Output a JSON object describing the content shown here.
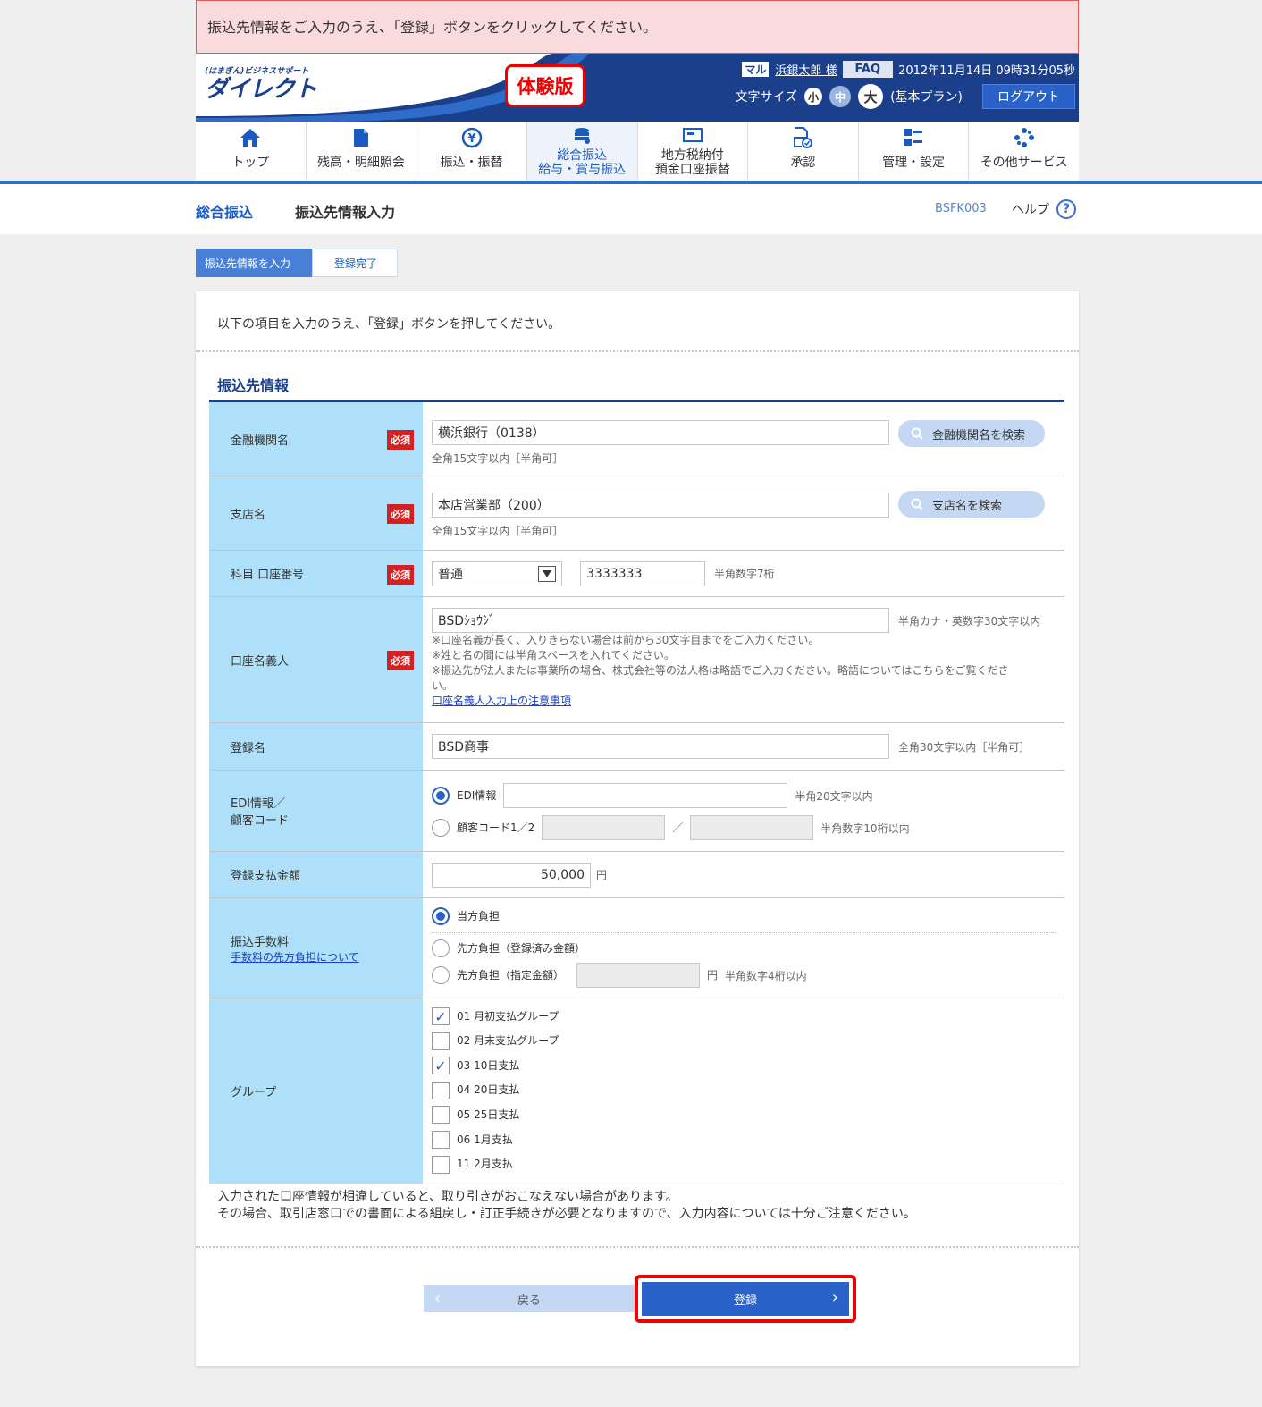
{
  "notice": "振込先情報をご入力のうえ、「登録」ボタンをクリックしてください。",
  "header": {
    "logo_small": "(はまぎん)ビジネスサポート",
    "logo_main": "ダイレクト",
    "trial_badge": "体験版",
    "bank_mark": "マル",
    "user": "浜銀太郎 様",
    "faq": "FAQ",
    "datetime": "2012年11月14日 09時31分05秒",
    "font_size_label": "文字サイズ",
    "font_small": "小",
    "font_medium": "中",
    "font_large": "大",
    "plan": "(基本プラン)",
    "logout": "ログアウト"
  },
  "nav": [
    {
      "label": "トップ",
      "icon": "home-icon"
    },
    {
      "label": "残高・明細照会",
      "icon": "document-icon"
    },
    {
      "label": "振込・振替",
      "icon": "yen-icon"
    },
    {
      "label1": "総合振込",
      "label2": "給与・賞与振込",
      "icon": "database-icon"
    },
    {
      "label1": "地方税納付",
      "label2": "預金口座振替",
      "icon": "tax-icon"
    },
    {
      "label": "承認",
      "icon": "approve-icon"
    },
    {
      "label": "管理・設定",
      "icon": "settings-icon"
    },
    {
      "label": "その他サービス",
      "icon": "service-icon"
    }
  ],
  "title": {
    "crumb1": "総合振込",
    "crumb2": "振込先情報入力",
    "screen_id": "BSFK003",
    "help": "ヘルプ",
    "help_icon": "?"
  },
  "steps": [
    "振込先情報を入力",
    "登録完了"
  ],
  "intro": "以下の項目を入力のうえ、「登録」ボタンを押してください。",
  "section_title": "振込先情報",
  "required": "必須",
  "fields": {
    "bank": {
      "label": "金融機関名",
      "value": "横浜銀行（0138）",
      "hint": "全角15文字以内［半角可］",
      "search": "金融機関名を検索"
    },
    "branch": {
      "label": "支店名",
      "value": "本店営業部（200）",
      "hint": "全角15文字以内［半角可］",
      "search": "支店名を検索"
    },
    "account": {
      "label": "科目 口座番号",
      "type": "普通",
      "number": "3333333",
      "hint": "半角数字7桁"
    },
    "holder": {
      "label": "口座名義人",
      "value": "BSDｼｮｳｼﾞ",
      "hint": "半角カナ・英数字30文字以内",
      "note1": "※口座名義が長く、入りきらない場合は前から30文字目までをご入力ください。",
      "note2": "※姓と名の間には半角スペースを入れてください。",
      "note3": "※振込先が法人または事業所の場合、株式会社等の法人格は略語でご入力ください。略語についてはこちらをご覧くださ",
      "note3b": "い。",
      "link": "口座名義人入力上の注意事項"
    },
    "regname": {
      "label": "登録名",
      "value": "BSD商事",
      "hint": "全角30文字以内［半角可］"
    },
    "edi": {
      "label1": "EDI情報／",
      "label2": "顧客コード",
      "opt1": "EDI情報",
      "hint1": "半角20文字以内",
      "opt2": "顧客コード1／2",
      "sep": "／",
      "hint2": "半角数字10桁以内"
    },
    "amount": {
      "label": "登録支払金額",
      "value": "50,000",
      "unit": "円"
    },
    "fee": {
      "label": "振込手数料",
      "link": "手数料の先方負担について",
      "opt1": "当方負担",
      "opt2": "先方負担（登録済み金額）",
      "opt3": "先方負担（指定金額）",
      "unit": "円",
      "hint": "半角数字4桁以内"
    },
    "group": {
      "label": "グループ",
      "items": [
        {
          "label": "01 月初支払グループ",
          "checked": true
        },
        {
          "label": "02 月末支払グループ",
          "checked": false
        },
        {
          "label": "03 10日支払",
          "checked": true
        },
        {
          "label": "04 20日支払",
          "checked": false
        },
        {
          "label": "05 25日支払",
          "checked": false
        },
        {
          "label": "06 1月支払",
          "checked": false
        },
        {
          "label": "11 2月支払",
          "checked": false
        }
      ]
    }
  },
  "notes": {
    "line1": "入力された口座情報が相違していると、取り引きがおこなえない場合があります。",
    "line2": "その場合、取引店窓口での書面による組戻し・訂正手続きが必要となりますので、入力内容については十分ご注意ください。"
  },
  "buttons": {
    "back": "戻る",
    "register": "登録"
  },
  "colors": {
    "primary": "#2a62c9",
    "label_bg": "#aee0fa",
    "navy": "#1b3f8b",
    "alert": "#e00000"
  }
}
